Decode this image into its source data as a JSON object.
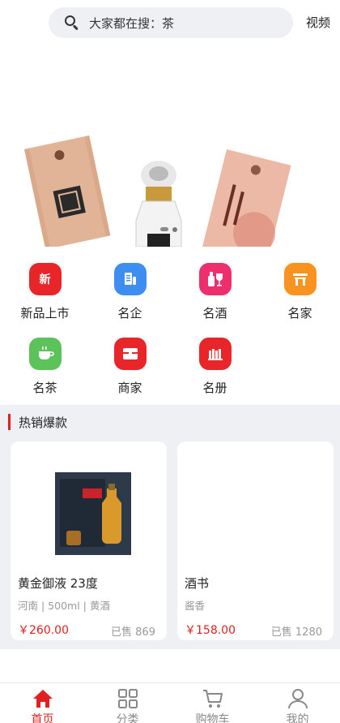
{
  "search": {
    "placeholder": "大家都在搜：茶",
    "video_label": "视频"
  },
  "categories": [
    {
      "label": "新品上市",
      "icon": "new-icon",
      "icon_text": "新",
      "color": "#e8262a"
    },
    {
      "label": "名企",
      "icon": "document-icon",
      "color": "#3d8ef0"
    },
    {
      "label": "名酒",
      "icon": "wine-bottle-icon",
      "color": "#ee2f6e"
    },
    {
      "label": "名家",
      "icon": "gate-icon",
      "color": "#f7931e"
    },
    {
      "label": "名茶",
      "icon": "tea-cup-icon",
      "color": "#5cc25a"
    },
    {
      "label": "商家",
      "icon": "shop-icon",
      "color": "#e8262a"
    },
    {
      "label": "名册",
      "icon": "book-shelf-icon",
      "color": "#e8262a"
    }
  ],
  "hot": {
    "title": "热销爆款",
    "products": [
      {
        "name": "黄金御液 23度",
        "spec": "河南 | 500ml | 黄酒",
        "price": "￥260.00",
        "sold": "已售 869"
      },
      {
        "name": "酒书",
        "spec": "酱香",
        "price": "￥158.00",
        "sold": "已售 1280"
      }
    ]
  },
  "tabs": [
    {
      "label": "首页",
      "icon": "home-icon",
      "active": true
    },
    {
      "label": "分类",
      "icon": "grid-icon",
      "active": false
    },
    {
      "label": "购物车",
      "icon": "cart-icon",
      "active": false
    },
    {
      "label": "我的",
      "icon": "user-icon",
      "active": false
    }
  ],
  "colors": {
    "accent": "#e02020",
    "section_bg": "#eef0f3"
  }
}
